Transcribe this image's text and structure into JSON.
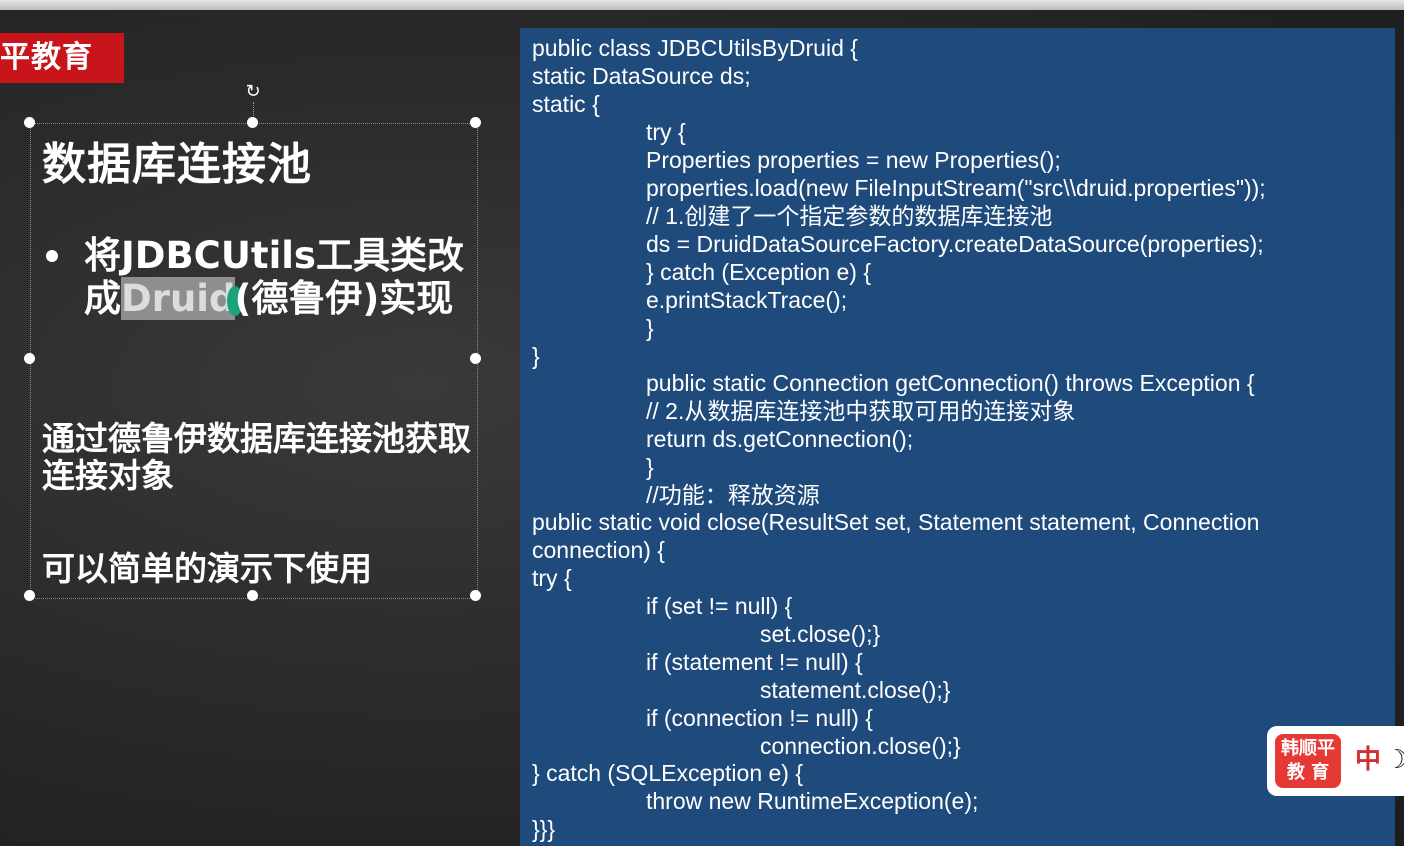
{
  "slide": {
    "brand_tag": "平教育",
    "title": "数据库连接池",
    "bullet_before": "将JDBCUtils工具类改成",
    "bullet_selected": "Druid",
    "bullet_after": "(德鲁伊)实现",
    "para1": "通过德鲁伊数据库连接池获取连接对象",
    "para2": "可以简单的演示下使用"
  },
  "code": {
    "lines": [
      "public class JDBCUtilsByDruid {",
      "static DataSource ds;",
      "static {",
      "try {",
      "Properties properties = new Properties();",
      "properties.load(new FileInputStream(\"src\\\\druid.properties\"));",
      "// 1.创建了一个指定参数的数据库连接池",
      "ds = DruidDataSourceFactory.createDataSource(properties);",
      "} catch (Exception e) {",
      "e.printStackTrace();",
      "}",
      "}",
      "public static Connection getConnection() throws Exception {",
      "// 2.从数据库连接池中获取可用的连接对象",
      "return ds.getConnection();",
      "}",
      "//功能：释放资源",
      "public static void close(ResultSet set, Statement statement, Connection",
      "connection) {",
      "try {",
      "if (set != null) {",
      "set.close();}",
      "if (statement != null) {",
      "statement.close();}",
      "if (connection != null) {",
      "connection.close();}",
      "} catch (SQLException e) {",
      "throw new RuntimeException(e);",
      "}}}"
    ]
  },
  "logo": {
    "badge_line1": "韩顺平",
    "badge_line2": "教 育",
    "lang": "中",
    "moon_glyph": "☽"
  },
  "icons": {
    "rotate": "↻"
  }
}
